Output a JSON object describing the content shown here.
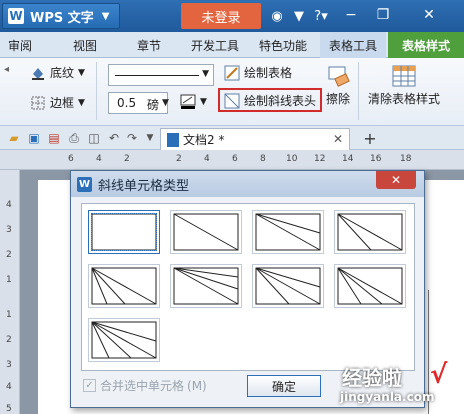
{
  "titlebar": {
    "app_logo": "W",
    "app_name": "WPS 文字",
    "login_label": "未登录",
    "help_label": "?",
    "icons": [
      "skin-icon",
      "shirt-icon",
      "help-icon",
      "minimize-icon",
      "restore-icon",
      "close-icon"
    ]
  },
  "tabs": [
    {
      "label": "审阅"
    },
    {
      "label": "视图"
    },
    {
      "label": "章节"
    },
    {
      "label": "开发工具"
    },
    {
      "label": "特色功能"
    },
    {
      "label": "表格工具"
    },
    {
      "label": "表格样式"
    }
  ],
  "ribbon": {
    "shading_label": "底纹",
    "border_label": "边框",
    "line_width_value": "0.5",
    "line_width_unit": "磅",
    "draw_table_label": "绘制表格",
    "draw_diag_header_label": "绘制斜线表头",
    "erase_label": "擦除",
    "clear_style_label": "清除表格样式"
  },
  "document": {
    "tab_name": "文档2 *",
    "ruler_top": [
      "6",
      "4",
      "2",
      "2",
      "4",
      "6",
      "8",
      "10",
      "12",
      "14",
      "16",
      "18"
    ],
    "ruler_left": [
      "4",
      "3",
      "2",
      "1",
      "1",
      "2",
      "3",
      "4",
      "5"
    ]
  },
  "dialog": {
    "logo": "W",
    "title": "斜线单元格类型",
    "close_label": "✕",
    "merge_label": "合并选中单元格",
    "merge_shortcut": "(M)",
    "ok_label": "确定"
  },
  "watermark": {
    "main": "经验啦",
    "sub": "jingyanla.com",
    "check": "√"
  },
  "colors": {
    "title_blue": "#2a6fb8",
    "login_orange": "#e2653f",
    "active_tab_green": "#4f9f3c",
    "highlight_red": "#d22b2b"
  }
}
